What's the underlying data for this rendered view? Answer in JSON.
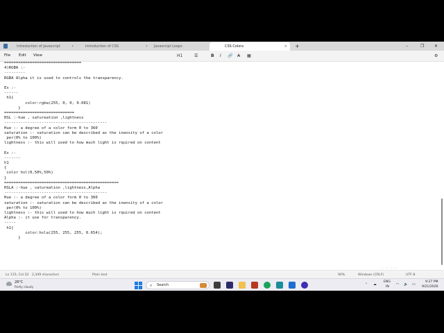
{
  "tabs": [
    {
      "label": "Introduction of Javascript",
      "close": "•"
    },
    {
      "label": "Introduction of CSS",
      "close": "•"
    },
    {
      "label": "Javascript Loops",
      "close": "•"
    },
    {
      "label": "CSS Colors",
      "close": "×"
    }
  ],
  "window_controls": {
    "minimize": "–",
    "maximize": "❐",
    "close": "✕"
  },
  "menu": {
    "file": "File",
    "edit": "Edit",
    "view": "View"
  },
  "toolbar": {
    "heading": "H1",
    "list": "☰",
    "bold": "B",
    "italic": "I",
    "link": "🔗",
    "clear": "A̶",
    "table": "▦",
    "settings": "⚙"
  },
  "lines": [
    "=================================",
    "4)RGBA :-",
    "---------",
    "RGBA Alpha it is used to controls the transparency.",
    "",
    "Ex :-",
    "------",
    " h1{",
    "         color:rgba(255, 0, 0, 0.081)",
    "      }",
    "==============================",
    "HSL :-hue , satureation ,lightness",
    "--------------------------------------------",
    "Hue :- a degree of a color form 0 to 360",
    "saturation :- saturation can be described as the inensity of a color",
    " per(0% to 100%)",
    "lightness :- this will used to how much light is rquired on content",
    "",
    "Ex :-",
    "-------",
    "h1",
    "{",
    " color hsl(0,50%,50%)",
    "}",
    "=================================================",
    "HSLA :-hue , satureation ,lightness,Alpha",
    "--------------------------------------------",
    "Hue :- a degree of a color form 0 to 360",
    "saturation :- saturation can be described as the inensity of a color",
    " per(0% to 100%)",
    "lightness :- this will used to how much light is rquired on content",
    "Alpha :- it use for transparency.",
    "-----",
    " h1{",
    "         color:hsla(255, 255, 255, 0.654);",
    "      }"
  ],
  "status": {
    "position": "Ln 115, Col 33",
    "chars": "2,349 characters",
    "format": "Plain text",
    "zoom": "90%",
    "eol": "Windows (CRLF)",
    "encoding": "UTF-8"
  },
  "taskbar": {
    "temperature": "28°C",
    "weather": "Partly cloudy",
    "search_placeholder": "Search",
    "lang_line1": "ENG",
    "lang_line2": "IN",
    "time": "9:27 PM",
    "date": "9/21/2026"
  },
  "colors": {
    "accent": "#1f7ae0",
    "editor_bg": "#ffffff",
    "taskbar_bg": "#ececf2"
  }
}
